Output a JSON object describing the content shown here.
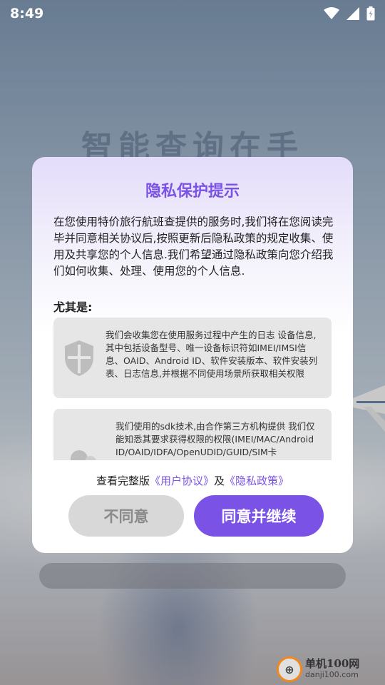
{
  "status_bar": {
    "time": "8:49"
  },
  "background": {
    "title": "智能查询在手"
  },
  "dialog": {
    "title": "隐私保护提示",
    "intro": "在您使用特价旅行航班查提供的服务时,我们将在您阅读完毕并同意相关协议后,按照更新后隐私政策的规定收集、使用及共享您的个人信息.我们希望通过隐私政策向您介绍我们如何收集、处理、使用您的个人信息.",
    "emphasis_label": "尤其是:",
    "cards": [
      {
        "icon": "shield-icon",
        "text": "我们会收集您在使用服务过程中产生的日志 设备信息,其中包括设备型号、唯一设备标识符如IMEI/IMSI信息、OAID、Android ID、软件安装版本、软件安装列表、日志信息,并根据不同使用场景所获取相关权限"
      },
      {
        "icon": "person-icon",
        "text": "我们使用的sdk技术,由合作第三方机构提供 我们仅能知悉其要求获得权限的权限(IMEI/MAC/Android ID/OAID/IDFA/OpenUDID/GUID/SIM卡IMSI/ICCID、软件安装列表、运行中的进程"
      }
    ],
    "agreement": {
      "prefix": "查看完整版",
      "user_agreement": "《用户协议》",
      "conjunction": "及",
      "privacy_policy": "《隐私政策》"
    },
    "buttons": {
      "disagree": "不同意",
      "agree": "同意并继续"
    }
  },
  "watermark": {
    "name": "单机100网",
    "url": "danji100.com"
  },
  "colors": {
    "accent": "#7a52e6",
    "disagree_bg": "#d8d8d8",
    "card_bg": "#e6e6e6"
  }
}
